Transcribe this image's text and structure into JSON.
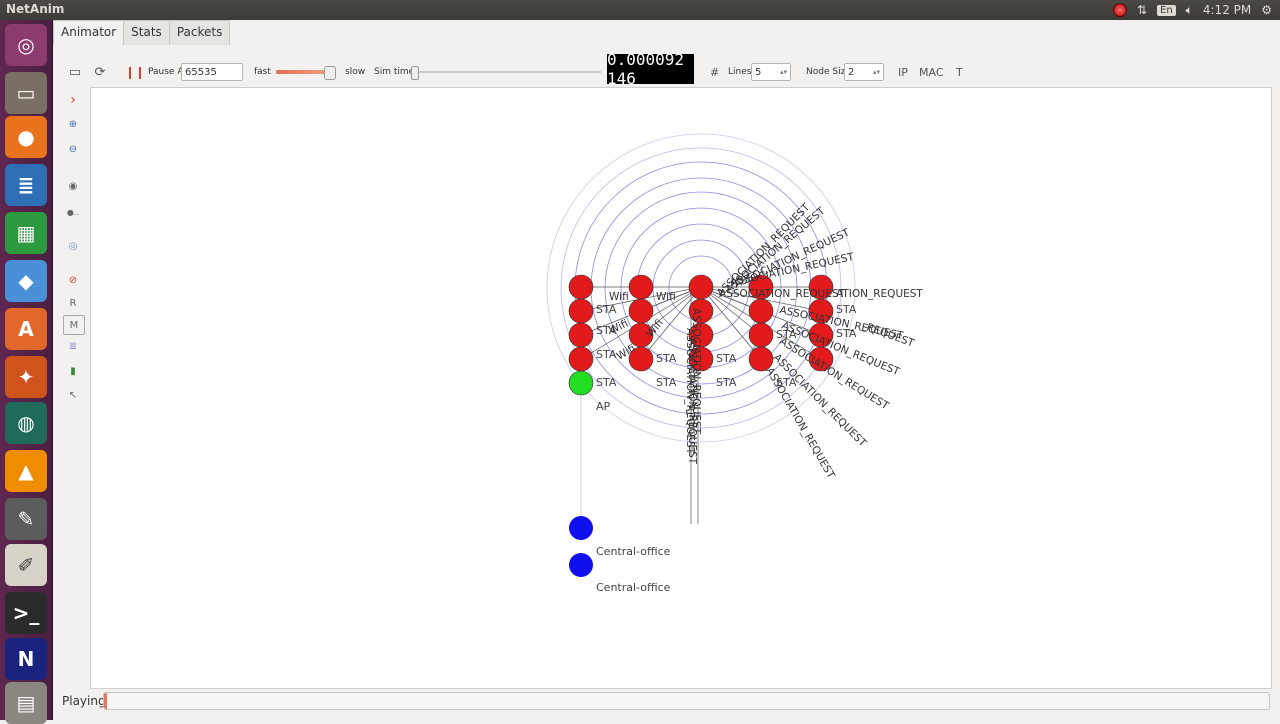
{
  "window": {
    "title": "NetAnim"
  },
  "tray": {
    "lang": "En",
    "time": "4:12 PM"
  },
  "tabs": [
    "Animator",
    "Stats",
    "Packets"
  ],
  "toolbar": {
    "pause_at_label": "Pause At",
    "pause_at_value": "65535",
    "fast_label": "fast",
    "slow_label": "slow",
    "sim_time_label": "Sim time",
    "sim_time_value": "0.000092 146",
    "lines_label": "Lines",
    "lines_value": "5",
    "node_size_label": "Node Size",
    "node_size_value": "2",
    "ip_label": "IP",
    "mac_label": "MAC",
    "t_label": "T",
    "hash_label": "#"
  },
  "sidebar": {
    "r_label": "R",
    "m_label": "M"
  },
  "status": {
    "text": "Playing"
  },
  "colors": {
    "sta": "#e31a1c",
    "ap": "#22dd22",
    "office": "#1010ee"
  },
  "labels": {
    "sta": "STA",
    "ap": "AP",
    "office": "Central-office",
    "assoc": "ASSOCIATION_REQUEST",
    "assoc_partial_1": "ATION_REQUEST",
    "assoc_partial_2": "_REQUEST",
    "wifi": "Wifi"
  }
}
